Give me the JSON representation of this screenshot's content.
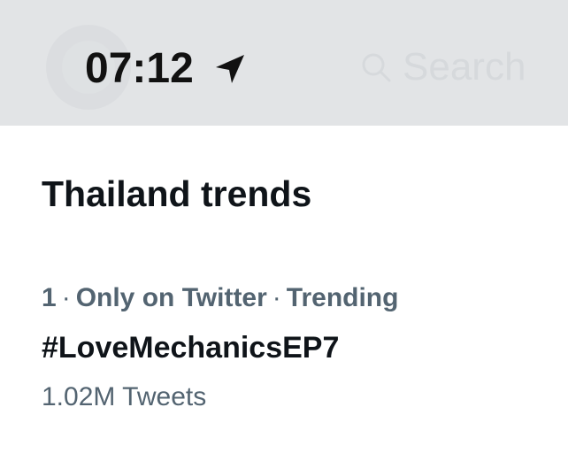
{
  "status_bar": {
    "time": "07:12",
    "location_icon": "location-arrow-icon"
  },
  "search": {
    "placeholder": "Search",
    "icon": "search-icon"
  },
  "trends": {
    "title": "Thailand trends",
    "items": [
      {
        "rank": "1",
        "context": "Only on Twitter",
        "status": "Trending",
        "name": "#LoveMechanicsEP7",
        "count": "1.02M Tweets"
      }
    ]
  },
  "colors": {
    "status_bar_bg": "#e2e4e6",
    "primary_text": "#0f1419",
    "secondary_text": "#536471"
  }
}
